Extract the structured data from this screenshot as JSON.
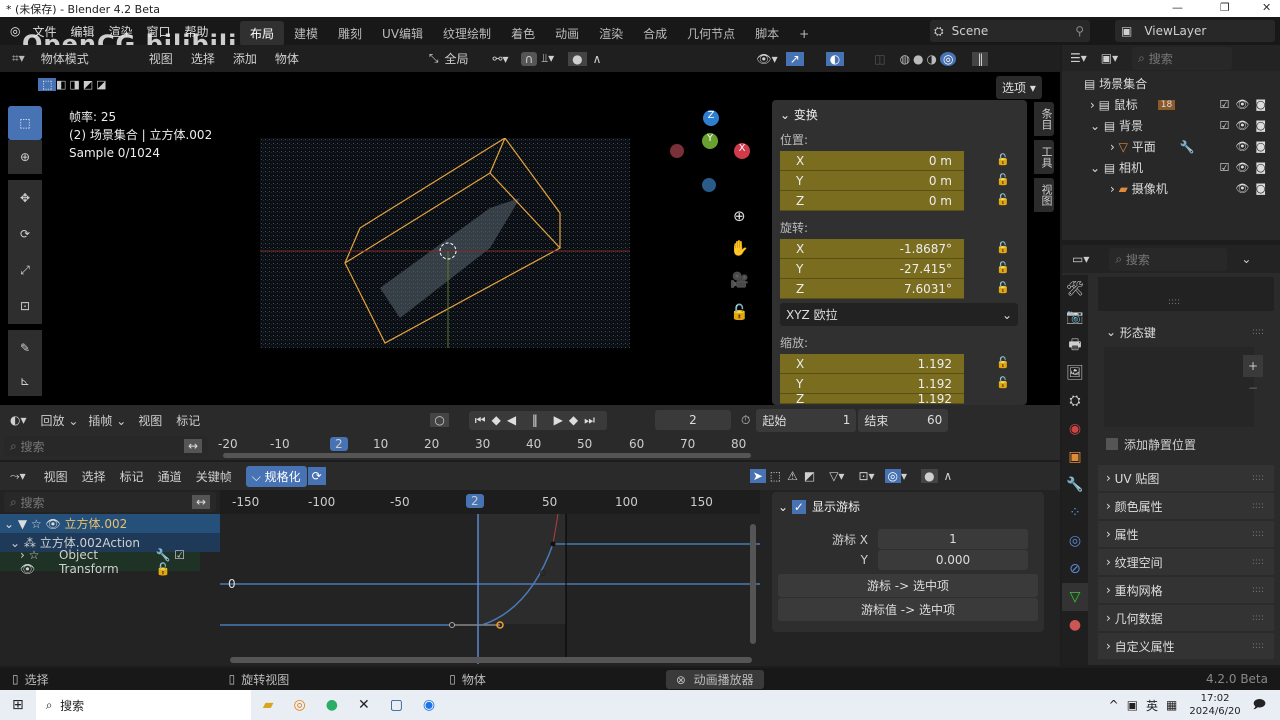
{
  "window": {
    "title": "* (未保存) - Blender 4.2 Beta",
    "min": "—",
    "max": "❐",
    "close": "✕"
  },
  "menu": [
    "文件",
    "编辑",
    "渲染",
    "窗口",
    "帮助"
  ],
  "workspaces": [
    "布局",
    "建模",
    "雕刻",
    "UV编辑",
    "纹理绘制",
    "着色",
    "动画",
    "渲染",
    "合成",
    "几何节点",
    "脚本",
    "+"
  ],
  "scene": "Scene",
  "view_layer": "ViewLayer",
  "watermark": "OpenCG bilibili",
  "viewport_header": {
    "mode": "物体模式",
    "view": "视图",
    "select": "选择",
    "add": "添加",
    "object": "物体",
    "orientation": "全局",
    "options": "选项"
  },
  "overlay_text": {
    "fps": "帧率: 25",
    "collection": "(2) 场景集合 | 立方体.002",
    "sample": "Sample 0/1024"
  },
  "gizmo": {
    "x": "X",
    "y": "Y",
    "z": "Z"
  },
  "npanel": {
    "title": "变换",
    "location_label": "位置:",
    "location": [
      {
        "axis": "X",
        "value": "0 m"
      },
      {
        "axis": "Y",
        "value": "0 m"
      },
      {
        "axis": "Z",
        "value": "0 m"
      }
    ],
    "rotation_label": "旋转:",
    "rotation": [
      {
        "axis": "X",
        "value": "-1.8687°"
      },
      {
        "axis": "Y",
        "value": "-27.415°"
      },
      {
        "axis": "Z",
        "value": "7.6031°"
      }
    ],
    "rotation_mode": "XYZ 欧拉",
    "scale_label": "缩放:",
    "scale": [
      {
        "axis": "X",
        "value": "1.192"
      },
      {
        "axis": "Y",
        "value": "1.192"
      },
      {
        "axis": "Z",
        "value": "1.192"
      }
    ],
    "tabs": [
      "条目",
      "工具",
      "视图"
    ]
  },
  "outliner": {
    "search_placeholder": "搜索",
    "items": [
      {
        "label": "场景集合"
      },
      {
        "label": "鼠标",
        "badge": "18"
      },
      {
        "label": "背景"
      },
      {
        "label": "平面"
      },
      {
        "label": "相机"
      },
      {
        "label": "摄像机"
      }
    ]
  },
  "properties": {
    "search_placeholder": "搜索",
    "shape_keys": "形态键",
    "add_rest": "添加静置位置",
    "sections": [
      "UV 贴图",
      "颜色属性",
      "属性",
      "纹理空间",
      "重构网格",
      "几何数据",
      "自定义属性"
    ]
  },
  "timeline": {
    "menus": [
      "回放",
      "插帧",
      "视图",
      "标记"
    ],
    "current_frame": "2",
    "start_label": "起始",
    "start": "1",
    "end_label": "结束",
    "end": "60",
    "search_placeholder": "搜索",
    "ticks": [
      "-20",
      "-10",
      "10",
      "20",
      "30",
      "40",
      "50",
      "60",
      "70",
      "80"
    ],
    "cursor": "2"
  },
  "graph": {
    "menus": [
      "视图",
      "选择",
      "标记",
      "通道",
      "关键帧"
    ],
    "normalize": "规格化",
    "search_placeholder": "搜索",
    "ticks": [
      "-150",
      "-100",
      "-50",
      "50",
      "100",
      "150"
    ],
    "cursor": "2",
    "zero_label": "0",
    "channels": [
      "立方体.002",
      "立方体.002Action",
      "Object Transform"
    ],
    "sidebar": {
      "title": "显示游标",
      "cursor_x_label": "游标 X",
      "cursor_x": "1",
      "cursor_y_label": "Y",
      "cursor_y": "0.000",
      "btn1": "游标 -> 选中项",
      "btn2": "游标值 -> 选中项"
    }
  },
  "status": {
    "select": "选择",
    "rotate": "旋转视图",
    "object": "物体",
    "player": "动画播放器",
    "version": "4.2.0 Beta"
  },
  "taskbar": {
    "search": "搜索",
    "lang": "英",
    "time": "17:02",
    "date": "2024/6/20"
  }
}
